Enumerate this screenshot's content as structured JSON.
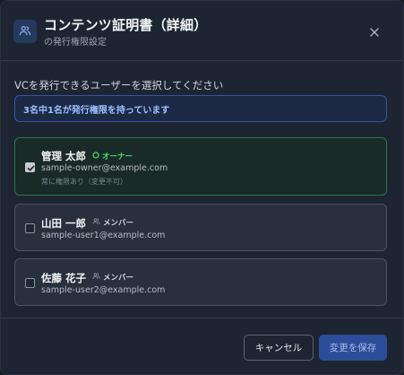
{
  "dialog": {
    "title": "コンテンツ証明書（詳細）",
    "subtitle": "の発行権限設定",
    "header_icon": "users-icon",
    "close_icon": "close-icon"
  },
  "body": {
    "instruction": "VCを発行できるユーザーを選択してください",
    "info_banner": "3名中1名が発行権限を持っています"
  },
  "users": [
    {
      "name": "管理 太郎",
      "role": "オーナー",
      "role_icon": "circle-icon",
      "email": "sample-owner@example.com",
      "note": "常に権限あり（変更不可）",
      "checked": true
    },
    {
      "name": "山田 一郎",
      "role": "メンバー",
      "role_icon": "users-icon",
      "email": "sample-user1@example.com",
      "checked": false
    },
    {
      "name": "佐藤 花子",
      "role": "メンバー",
      "role_icon": "users-icon",
      "email": "sample-user2@example.com",
      "checked": false
    }
  ],
  "footer": {
    "cancel_label": "キャンセル",
    "save_label": "変更を保存"
  },
  "colors": {
    "dialog_bg": "#1e2532",
    "owner_accent": "#4ade80",
    "owner_border": "#23794a",
    "info_bg": "#1c2a45",
    "info_text": "#9cc2ff",
    "primary_button": "#2c4d9a"
  }
}
